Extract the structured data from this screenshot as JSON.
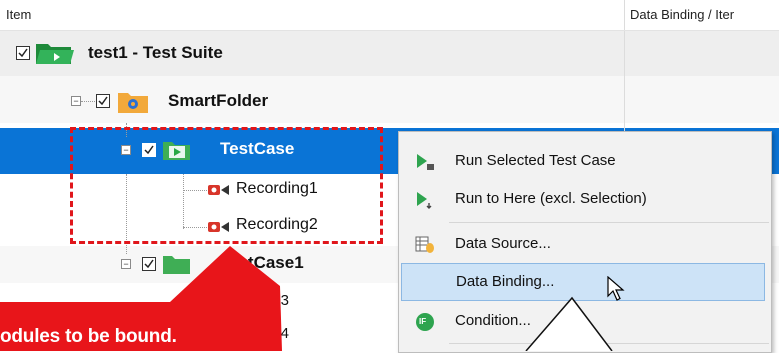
{
  "header": {
    "col_item": "Item",
    "col_binding": "Data Binding / Iter"
  },
  "tree": {
    "suite": "test1 - Test Suite",
    "folder": "SmartFolder",
    "testcase": "TestCase",
    "recording1": "Recording1",
    "recording2": "Recording2",
    "testcase1": "estCase1",
    "rec3": "ng3",
    "rec4": "ng4"
  },
  "menu": {
    "items": [
      {
        "label": "Run Selected Test Case",
        "icon": "run-selected-icon"
      },
      {
        "label": "Run to Here (excl. Selection)",
        "icon": "run-to-here-icon"
      },
      {
        "label": "Data Source...",
        "icon": "data-source-icon"
      },
      {
        "label": "Data Binding...",
        "icon": "none"
      },
      {
        "label": "Condition...",
        "icon": "condition-icon"
      }
    ],
    "condition_badge": "IF"
  },
  "annotation": {
    "callout_text": "odules to be bound."
  },
  "colors": {
    "selection": "#0a74d6",
    "annotation_red": "#e0161b",
    "menu_highlight": "#cde3f7"
  }
}
